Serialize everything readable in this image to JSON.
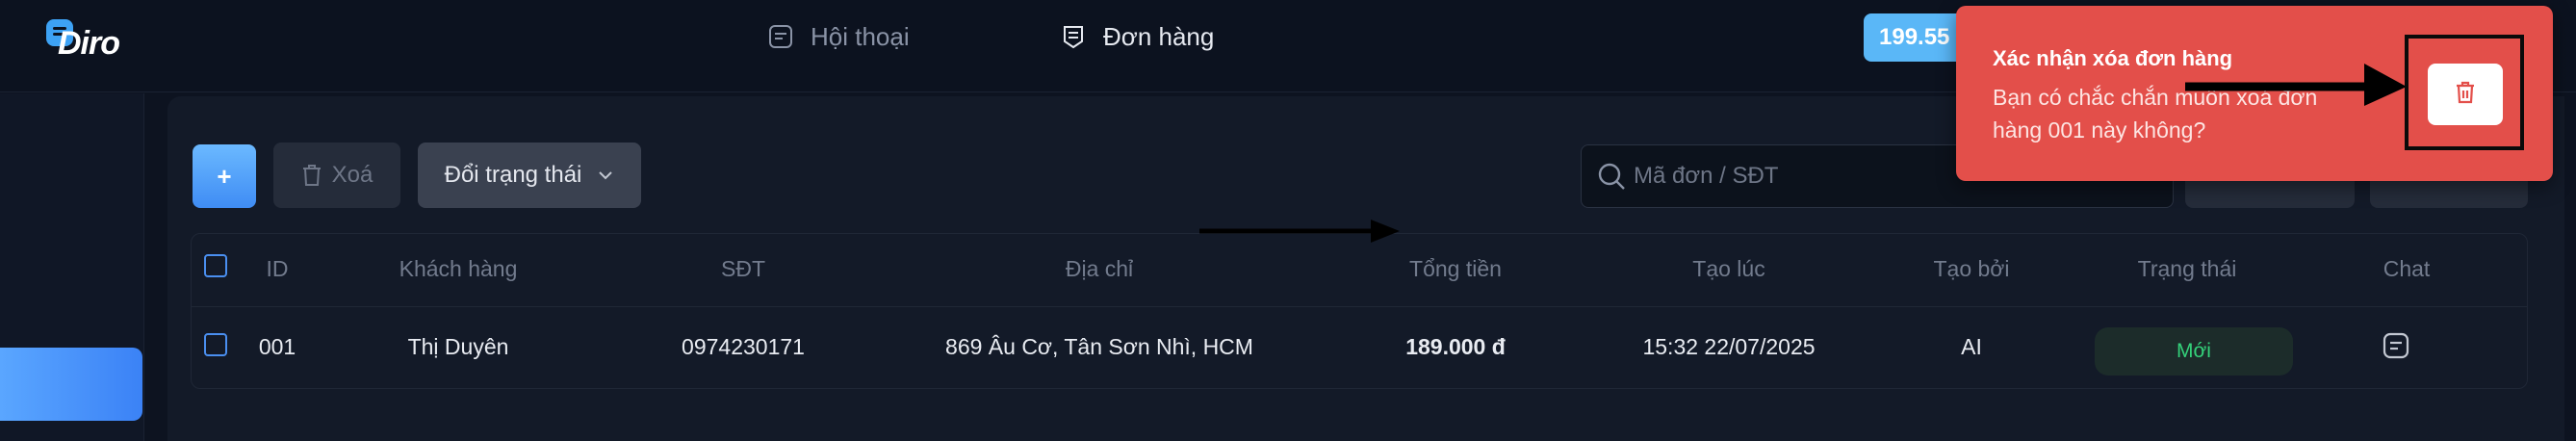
{
  "app": {
    "logo_text": "Diro",
    "brand_color": "#3da2f5"
  },
  "nav": {
    "items": [
      {
        "label": "Hội thoại",
        "icon": "chat-bubble-icon"
      },
      {
        "label": "Đơn hàng",
        "icon": "receipt-icon"
      }
    ],
    "credit": "199.55"
  },
  "toolbar": {
    "add_label": "+",
    "delete_label": "Xoá",
    "status_label": "Đổi trạng thái",
    "search_placeholder": "Mã đơn / SĐT"
  },
  "table": {
    "columns": [
      "ID",
      "Khách hàng",
      "SĐT",
      "Địa chỉ",
      "Tổng tiền",
      "Tạo lúc",
      "Tạo bởi",
      "Trạng thái",
      "Chat"
    ],
    "rows": [
      {
        "id": "001",
        "customer": "Thị Duyên",
        "phone": "0974230171",
        "address": "869 Âu Cơ, Tân Sơn Nhì, HCM",
        "total": "189.000 đ",
        "created_at": "15:32 22/07/2025",
        "created_by": "AI",
        "status": "Mới"
      }
    ]
  },
  "toast": {
    "title": "Xác nhận xóa đơn hàng",
    "message_line1": "Bạn có chắc chắn muốn xoá đơn",
    "message_line2": "hàng 001 này không?",
    "background": "#e34f4a"
  },
  "colors": {
    "status_new": "#34d17a",
    "accent_blue": "#3f8cf4"
  }
}
